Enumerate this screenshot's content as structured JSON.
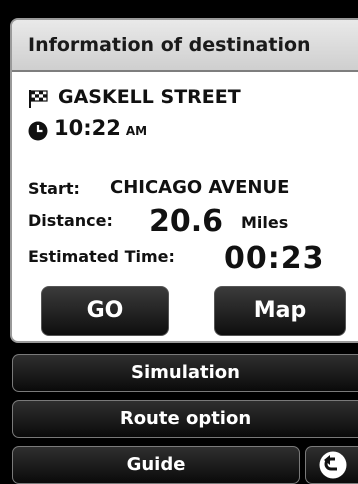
{
  "header": {
    "title": "Information of destination"
  },
  "destination": {
    "icon": "checkered-flag-icon",
    "name": "GASKELL STREET"
  },
  "arrival": {
    "icon": "clock-icon",
    "time": "10:22",
    "ampm": "AM"
  },
  "route": {
    "start_label": "Start:",
    "start_value": "CHICAGO AVENUE",
    "distance_label": "Distance:",
    "distance_value": "20.6",
    "distance_unit": "Miles",
    "eta_label": "Estimated Time:",
    "eta_value": "00:23"
  },
  "actions": {
    "go": "GO",
    "map": "Map"
  },
  "menu": {
    "simulation": "Simulation",
    "route_option": "Route option",
    "guide": "Guide"
  },
  "back": {
    "icon": "back-arrow-icon"
  }
}
